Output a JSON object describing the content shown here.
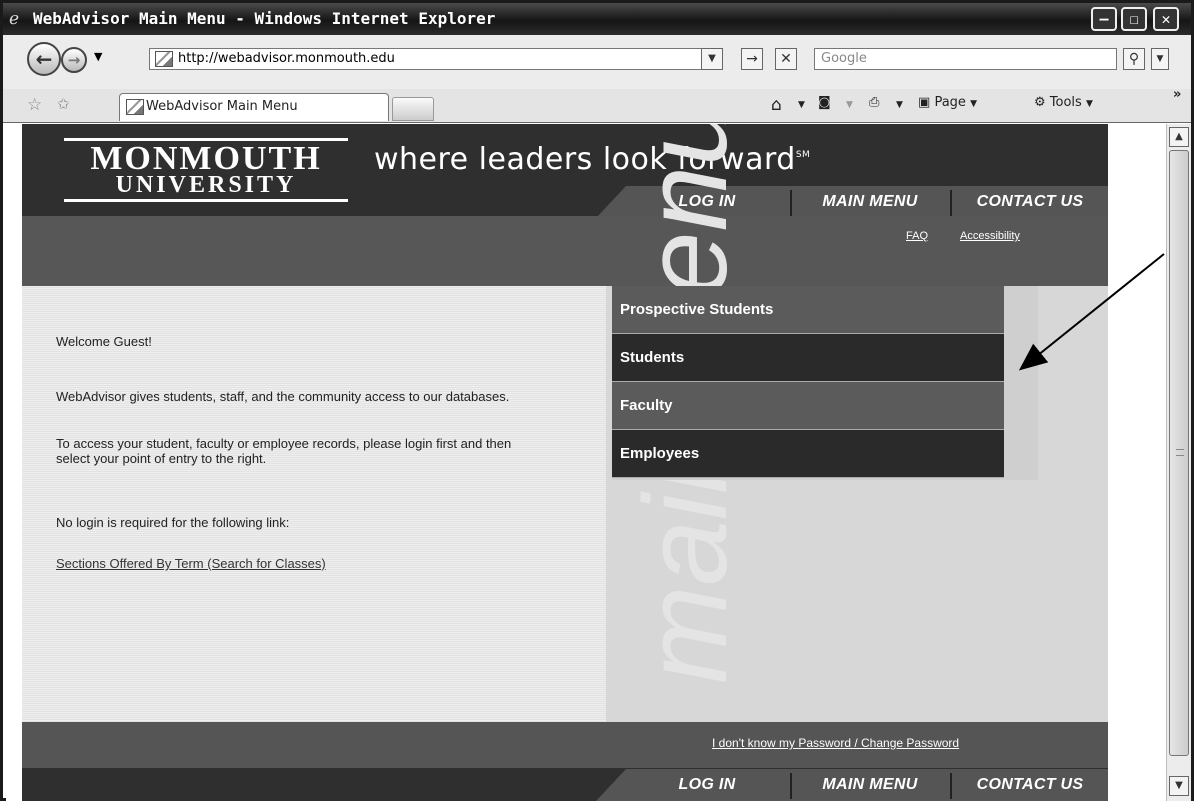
{
  "window": {
    "title": "WebAdvisor Main Menu - Windows Internet Explorer",
    "minimize_glyph": "‒",
    "maximize_glyph": "☐",
    "close_glyph": "✕"
  },
  "browser": {
    "address": "http://webadvisor.monmouth.edu",
    "search_placeholder": "Google",
    "tab_title": "WebAdvisor Main Menu",
    "page_label": "Page",
    "tools_label": "Tools",
    "overflow_glyph": "»"
  },
  "site": {
    "logo_line1": "MONMOUTH",
    "logo_line2": "UNIVERSITY",
    "tagline": "where leaders look forward",
    "tagline_mark": "SM",
    "nav": {
      "login": "LOG IN",
      "main_menu": "MAIN MENU",
      "contact": "CONTACT US"
    },
    "links": {
      "faq": "FAQ",
      "accessibility": "Accessibility"
    },
    "welcome": "Welcome Guest!",
    "intro": "WebAdvisor gives students, staff, and the community access to our databases.",
    "access_text": "To access your student, faculty or employee records, please login first and then select your point of entry to the right.",
    "no_login_text": "No login is required for the following link:",
    "sections_link": "Sections Offered By Term (Search for Classes)",
    "watermark": "main menu",
    "menu": [
      "Prospective Students",
      "Students",
      "Faculty",
      "Employees"
    ],
    "password_link": "I don't know my Password / Change Password"
  }
}
